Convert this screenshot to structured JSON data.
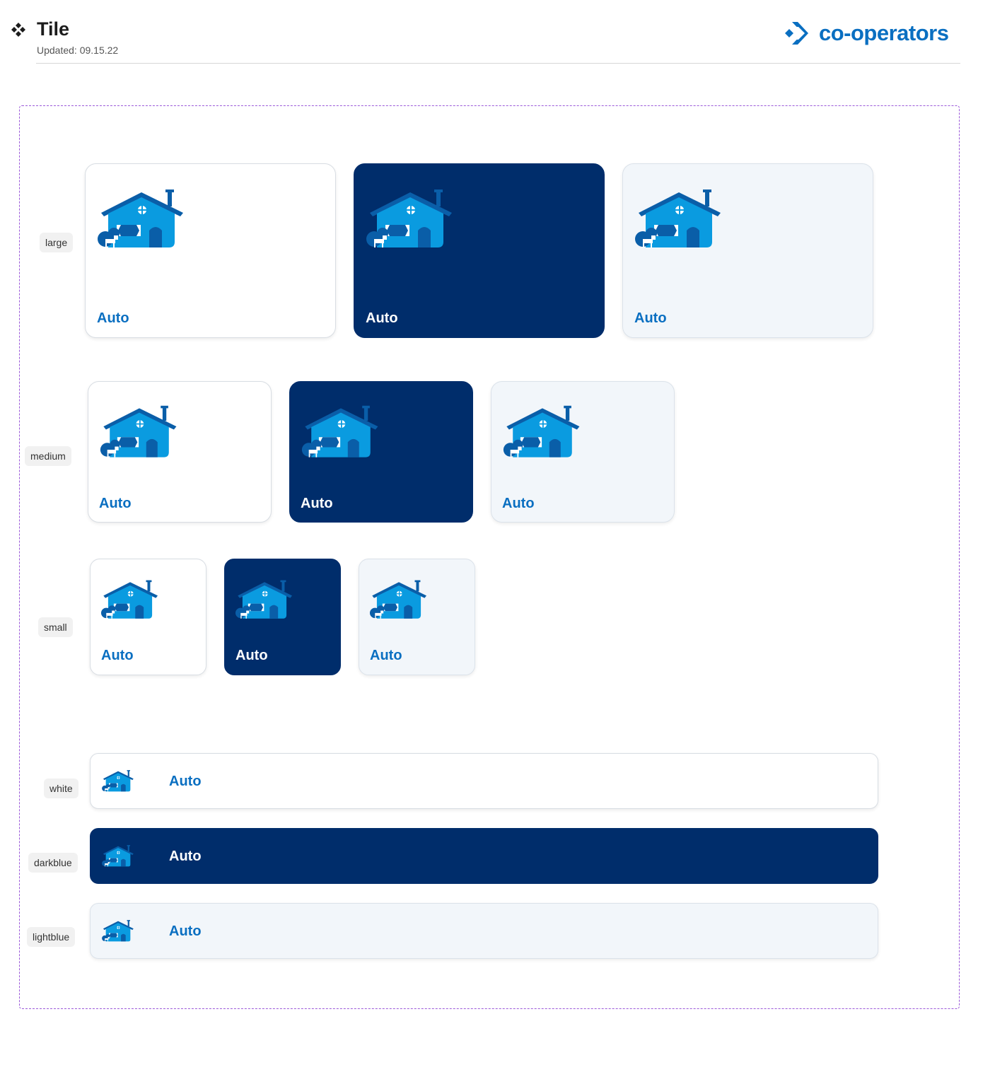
{
  "header": {
    "title": "Tile",
    "updated": "Updated: 09.15.22",
    "logo_text": "co-operators"
  },
  "colors": {
    "brand_blue": "#0a6fc1",
    "dark_blue": "#002d6b",
    "light_blue": "#f2f6fa",
    "frame_border": "#9b59d9"
  },
  "variant_labels": {
    "large": "large",
    "medium": "medium",
    "small": "small",
    "white": "white",
    "darkblue": "darkblue",
    "lightblue": "lightblue"
  },
  "tiles": {
    "large": [
      {
        "style": "white",
        "label": "Auto",
        "icon": "house-icon",
        "action_icon": "arrow-right-icon"
      },
      {
        "style": "darkblue",
        "label": "Auto",
        "icon": "house-icon",
        "action_icon": "arrow-right-icon"
      },
      {
        "style": "lightblue",
        "label": "Auto",
        "icon": "house-icon",
        "action_icon": "arrow-right-icon"
      }
    ],
    "medium": [
      {
        "style": "white",
        "label": "Auto",
        "icon": "house-icon",
        "action_icon": "arrow-right-icon"
      },
      {
        "style": "darkblue",
        "label": "Auto",
        "icon": "house-icon",
        "action_icon": "arrow-right-icon"
      },
      {
        "style": "lightblue",
        "label": "Auto",
        "icon": "house-icon",
        "action_icon": "arrow-right-icon"
      }
    ],
    "small": [
      {
        "style": "white",
        "label": "Auto",
        "icon": "house-icon",
        "action_icon": "arrow-right-icon"
      },
      {
        "style": "darkblue",
        "label": "Auto",
        "icon": "house-icon",
        "action_icon": "arrow-right-icon"
      },
      {
        "style": "lightblue",
        "label": "Auto",
        "icon": "house-icon",
        "action_icon": "arrow-right-icon"
      }
    ],
    "bars": [
      {
        "style": "white",
        "label": "Auto",
        "icon": "house-icon",
        "action_icon": "arrow-right-icon"
      },
      {
        "style": "darkblue",
        "label": "Auto",
        "icon": "house-icon",
        "action_icon": "arrow-right-icon"
      },
      {
        "style": "lightblue",
        "label": "Auto",
        "icon": "house-icon",
        "action_icon": "arrow-right-icon"
      }
    ]
  }
}
